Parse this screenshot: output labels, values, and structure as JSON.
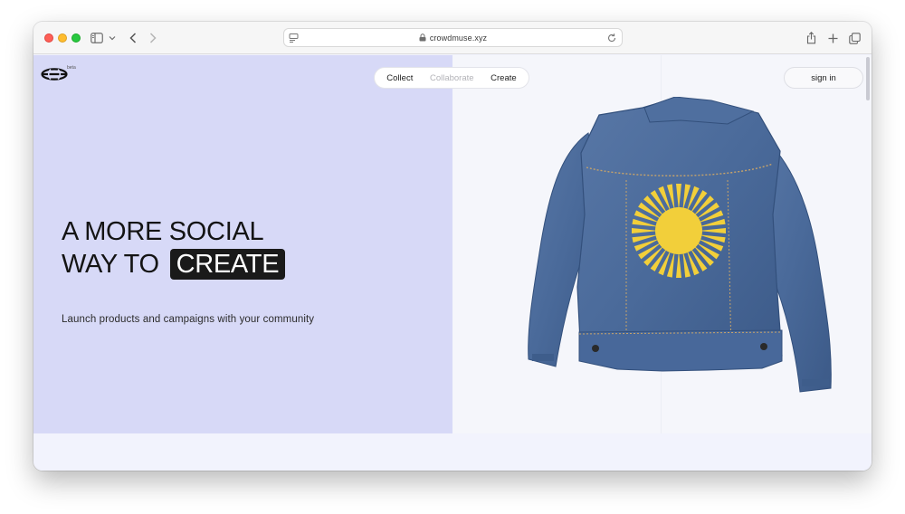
{
  "browser": {
    "url": "crowdmuse.xyz",
    "icons": [
      "sidebar-toggle-icon",
      "chevron-down-icon",
      "back-arrow-icon",
      "forward-arrow-icon",
      "page-menu-icon",
      "lock-icon",
      "reload-icon",
      "share-icon",
      "new-tab-icon",
      "tabs-overview-icon"
    ]
  },
  "header": {
    "logo_badge": "beta",
    "nav": [
      {
        "label": "Collect"
      },
      {
        "label": "Collaborate"
      },
      {
        "label": "Create"
      }
    ],
    "sign_in_label": "sign in"
  },
  "hero": {
    "headline_line1": "A MORE SOCIAL",
    "headline_line2_prefix": "WAY TO",
    "headline_highlight": "CREATE",
    "subheadline": "Launch products and campaigns with your community",
    "image_icon": "denim-jacket-sun-image"
  },
  "colors": {
    "hero_left_bg": "#d7d9f7",
    "hero_right_bg": "#f5f6fb",
    "page_bg": "#f2f3fd",
    "highlight_bg": "#1a1a1a",
    "denim": "#4a6a9a",
    "sun": "#f2cf3a"
  }
}
